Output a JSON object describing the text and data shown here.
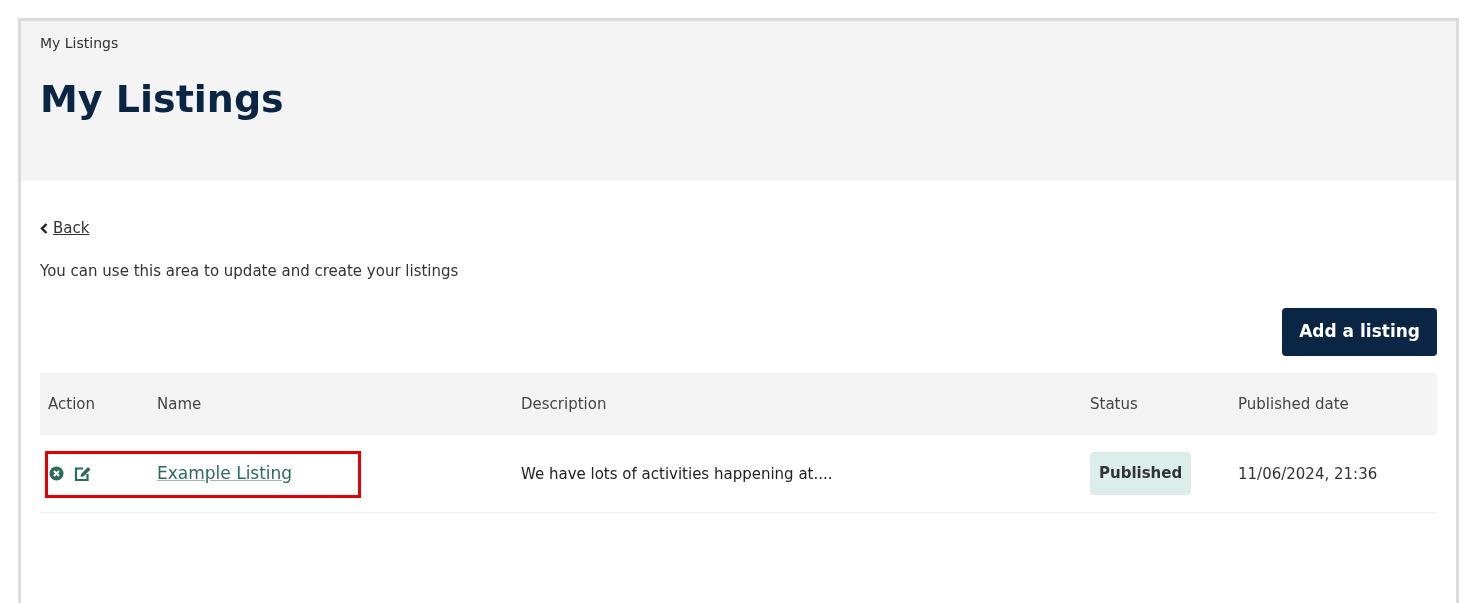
{
  "breadcrumb": "My Listings",
  "title": "My Listings",
  "back_link": "Back",
  "intro": "You can use this area to update and create your listings",
  "add_button": "Add a listing",
  "table": {
    "columns": [
      "Action",
      "Name",
      "Description",
      "Status",
      "Published date"
    ],
    "rows": [
      {
        "name": "Example Listing",
        "description": "We have lots of activities happening at....",
        "status": "Published",
        "published_date": "11/06/2024, 21:36",
        "highlighted": true
      }
    ]
  }
}
